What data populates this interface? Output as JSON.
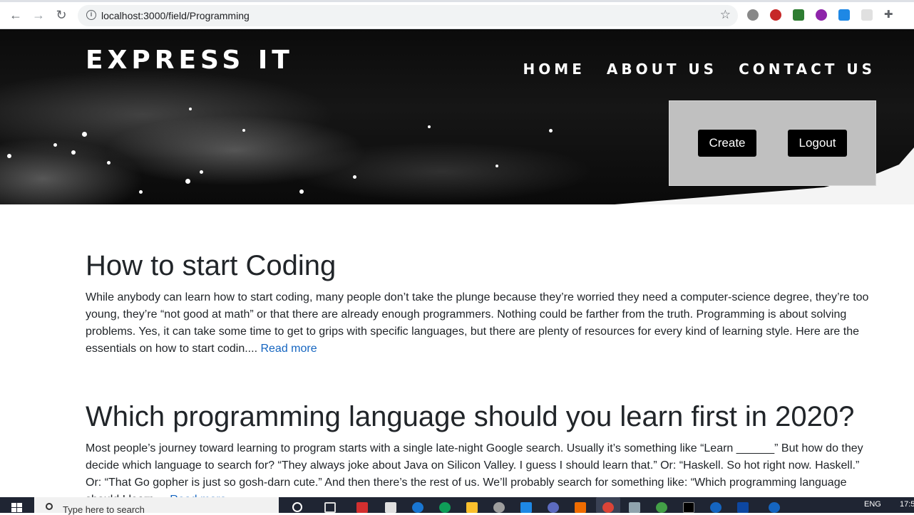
{
  "browser": {
    "url": "localhost:3000/field/Programming",
    "back_glyph": "←",
    "forward_glyph": "→",
    "reload_glyph": "↻",
    "info_glyph": "i",
    "star_glyph": "☆",
    "extensions": [
      "extension-icon-1",
      "extension-icon-2",
      "extension-icon-3",
      "extension-icon-4",
      "extension-icon-5",
      "extension-icon-6",
      "puzzle-icon"
    ]
  },
  "site": {
    "brand": "EXPRESS IT",
    "nav": {
      "home": "HOME",
      "about": "ABOUT US",
      "contact": "CONTACT US"
    },
    "actions": {
      "create": "Create",
      "logout": "Logout"
    }
  },
  "articles": [
    {
      "title": "How to start Coding",
      "excerpt": "While anybody can learn how to start coding, many people don’t take the plunge because they’re worried they need a computer-science degree, they’re too young, they’re “not good at math” or that there are already enough programmers. Nothing could be farther from the truth. Programming is about solving problems. Yes, it can take some time to get to grips with specific languages, but there are plenty of resources for every kind of learning style. Here are the essentials on how to start codin....",
      "read_more": "Read more"
    },
    {
      "title": "Which programming language should you learn first in 2020?",
      "excerpt": "Most people’s journey toward learning to program starts with a single late-night Google search. Usually it’s something like “Learn ______” But how do they decide which language to search for? “They always joke about Java on Silicon Valley. I guess I should learn that.” Or: “Haskell. So hot right now. Haskell.” Or: “That Go gopher is just so gosh-darn cute.” And then there’s the rest of us. We’ll probably search for something like: “Which programming language should I learn....",
      "read_more": "Read more"
    }
  ],
  "taskbar": {
    "search_placeholder": "Type here to search",
    "lang": "ENG",
    "time": "17:5"
  },
  "colors": {
    "hero_bg": "#0b0b0b",
    "panel": "#c0c0c0",
    "button": "#000000",
    "link": "#1565c0",
    "taskbar": "#1f2533"
  }
}
